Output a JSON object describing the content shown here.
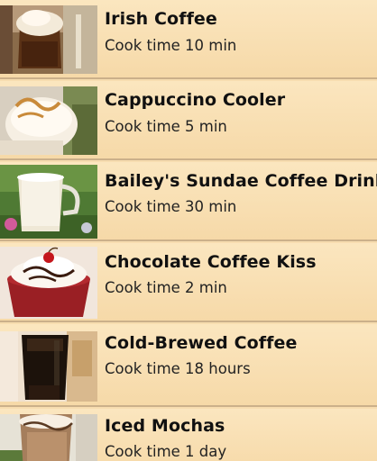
{
  "recipes": [
    {
      "title": "Irish Coffee",
      "cook_time": "Cook time 10 min",
      "image": "irish-coffee-photo"
    },
    {
      "title": "Cappuccino Cooler",
      "cook_time": "Cook time 5 min",
      "image": "cappuccino-cooler-photo"
    },
    {
      "title": "Bailey's Sundae Coffee Drink",
      "cook_time": "Cook time 30 min",
      "image": "baileys-sundae-photo"
    },
    {
      "title": "Chocolate Coffee Kiss",
      "cook_time": "Cook time 2 min",
      "image": "chocolate-coffee-kiss-photo"
    },
    {
      "title": "Cold-Brewed Coffee",
      "cook_time": "Cook time 18 hours",
      "image": "cold-brewed-coffee-photo"
    },
    {
      "title": "Iced Mochas",
      "cook_time": "Cook time 1 day",
      "image": "iced-mochas-photo"
    }
  ],
  "colors": {
    "row_background": "#f7ddb0",
    "divider": "#cbb08a",
    "title_text": "#111111"
  }
}
